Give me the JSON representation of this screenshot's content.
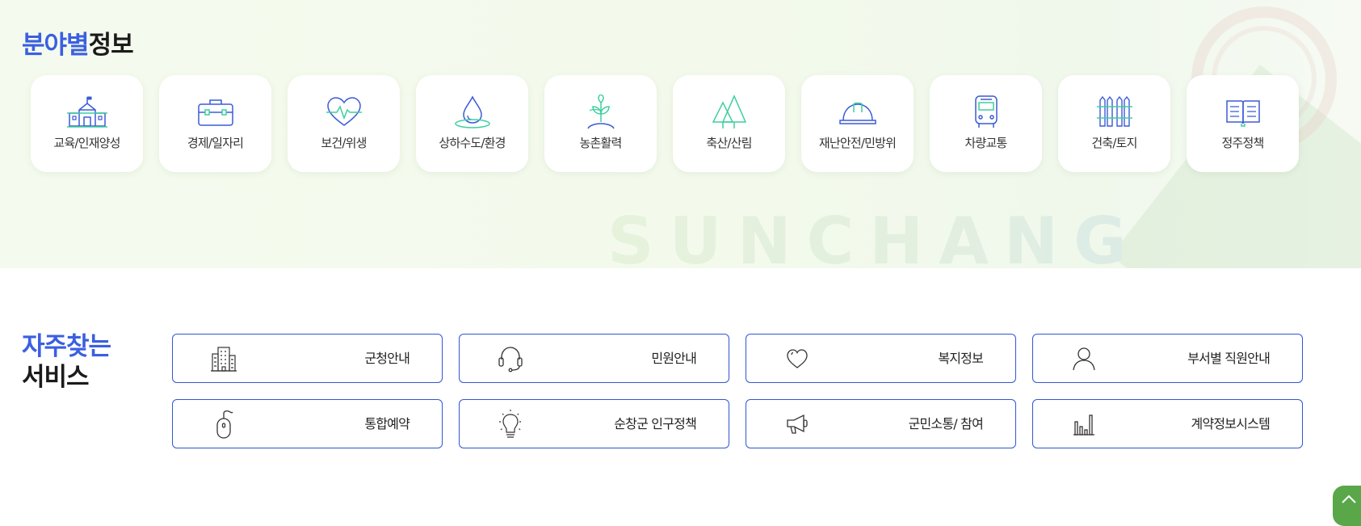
{
  "field_info": {
    "title_accent": "분야별",
    "title_rest": "정보",
    "watermark": "SUNCHANG",
    "categories": [
      {
        "label": "교육/인재양성",
        "icon": "school-icon"
      },
      {
        "label": "경제/일자리",
        "icon": "briefcase-icon"
      },
      {
        "label": "보건/위생",
        "icon": "heartbeat-icon"
      },
      {
        "label": "상하수도/환경",
        "icon": "water-drop-icon"
      },
      {
        "label": "농촌활력",
        "icon": "sprout-icon"
      },
      {
        "label": "축산/산림",
        "icon": "trees-icon"
      },
      {
        "label": "재난안전/민방위",
        "icon": "safety-helmet-icon"
      },
      {
        "label": "차량교통",
        "icon": "bus-icon"
      },
      {
        "label": "건축/토지",
        "icon": "fence-icon"
      },
      {
        "label": "정주정책",
        "icon": "open-book-icon"
      }
    ]
  },
  "services": {
    "title_line1": "자주찾는",
    "title_line2": "서비스",
    "items": [
      {
        "label": "군청안내",
        "icon": "building-icon"
      },
      {
        "label": "민원안내",
        "icon": "headset-icon"
      },
      {
        "label": "복지정보",
        "icon": "heart-icon"
      },
      {
        "label": "부서별 직원안내",
        "icon": "person-icon"
      },
      {
        "label": "통합예약",
        "icon": "mouse-icon"
      },
      {
        "label": "순창군 인구정책",
        "icon": "lightbulb-icon"
      },
      {
        "label": "군민소통/ 참여",
        "icon": "megaphone-icon"
      },
      {
        "label": "계약정보시스템",
        "icon": "bar-chart-icon"
      }
    ]
  },
  "colors": {
    "accent_blue": "#3b5fe0",
    "icon_blue": "#3b5bd6",
    "icon_green": "#3ecf9e",
    "border_blue": "#3256d1",
    "fab_green": "#5aa74a"
  }
}
